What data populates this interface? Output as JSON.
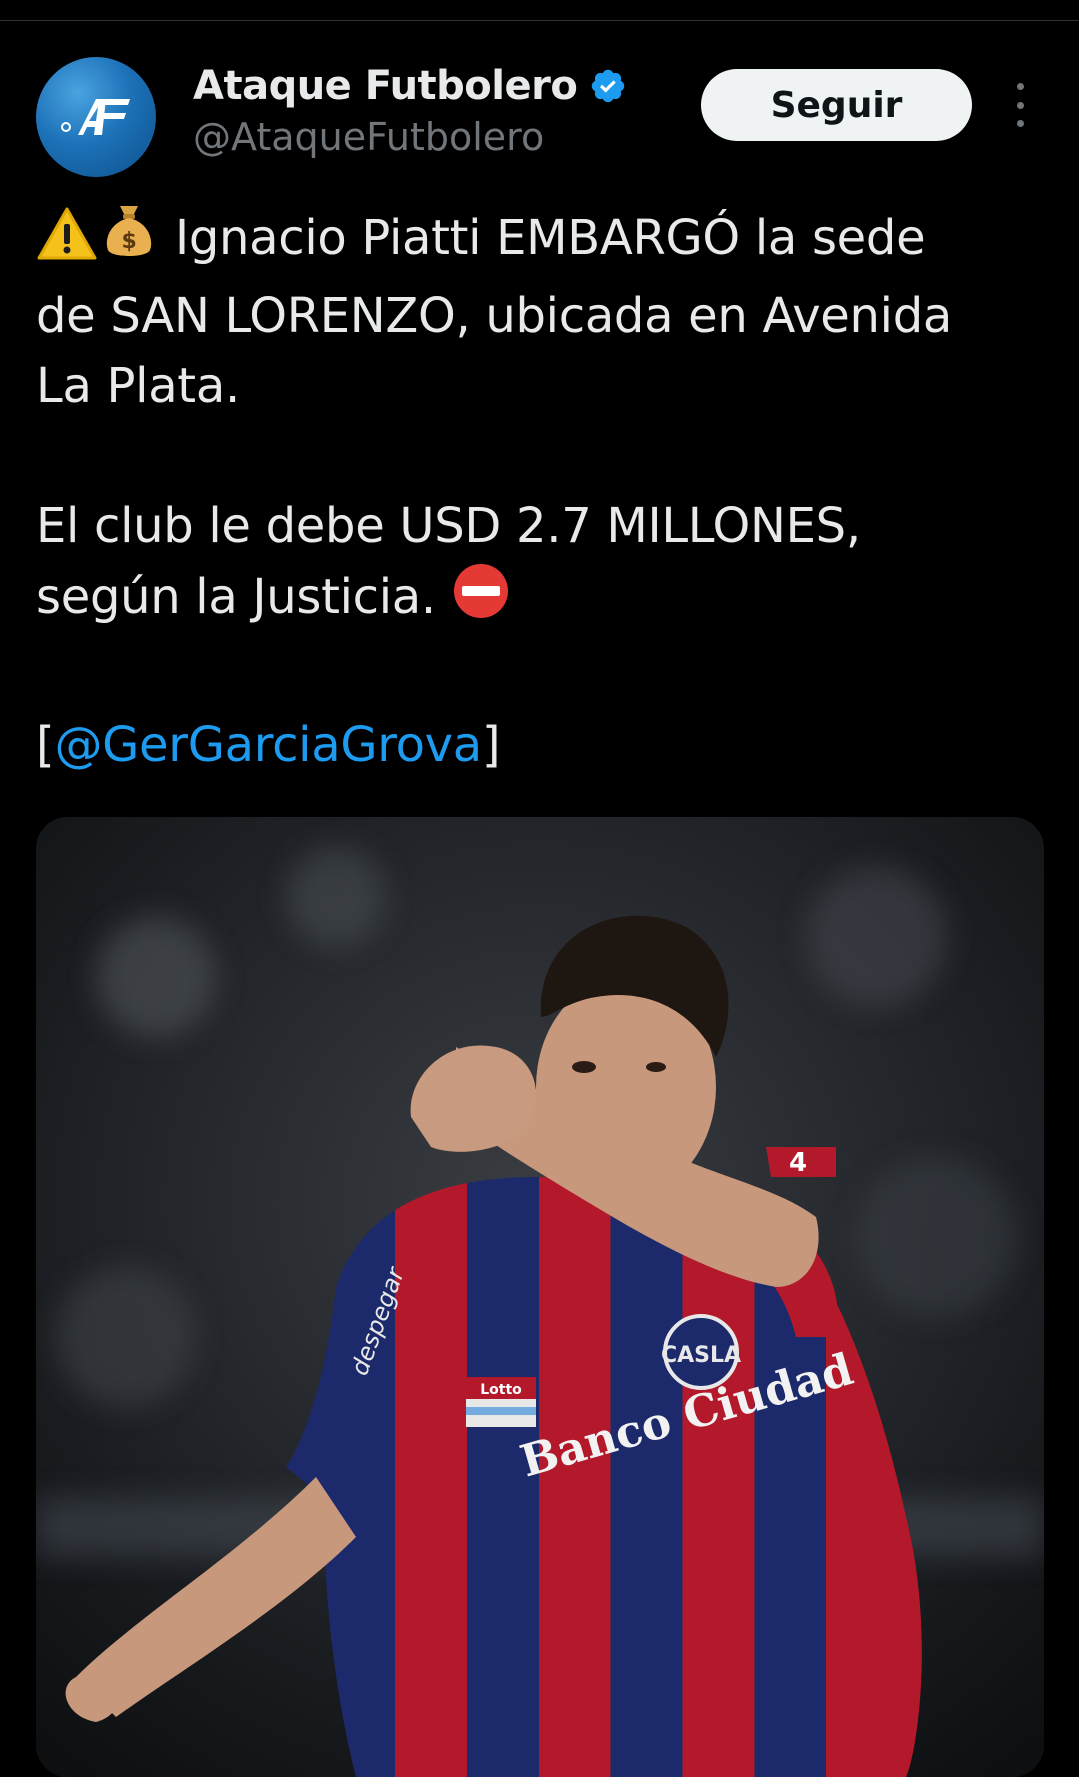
{
  "account": {
    "display_name": "Ataque Futbolero",
    "handle": "@AtaqueFutbolero",
    "verified": true,
    "avatar_text": "AF"
  },
  "actions": {
    "follow_label": "Seguir"
  },
  "tweet": {
    "line1_text": "Ignacio Piatti EMBARGÓ la sede",
    "line2_text": "de SAN LORENZO, ubicada en Avenida",
    "line3_text": "La Plata.",
    "line4_text": "El club le debe USD 2.7 MILLONES,",
    "line5_text": "según la Justicia.",
    "mention_open": "[",
    "mention": "@GerGarciaGrova",
    "mention_close": "]"
  },
  "media": {
    "jersey_text_sponsor": "Banco Ciudad",
    "jersey_brand": "Lotto",
    "jersey_side_text": "despegar",
    "jersey_crest": "CASLA",
    "sleeve_number": "4"
  },
  "colors": {
    "background": "#000000",
    "text": "#e7e9ea",
    "secondary_text": "#71767b",
    "link": "#1d9bf0",
    "verified": "#1d9bf0",
    "follow_bg": "#eff3f4"
  }
}
